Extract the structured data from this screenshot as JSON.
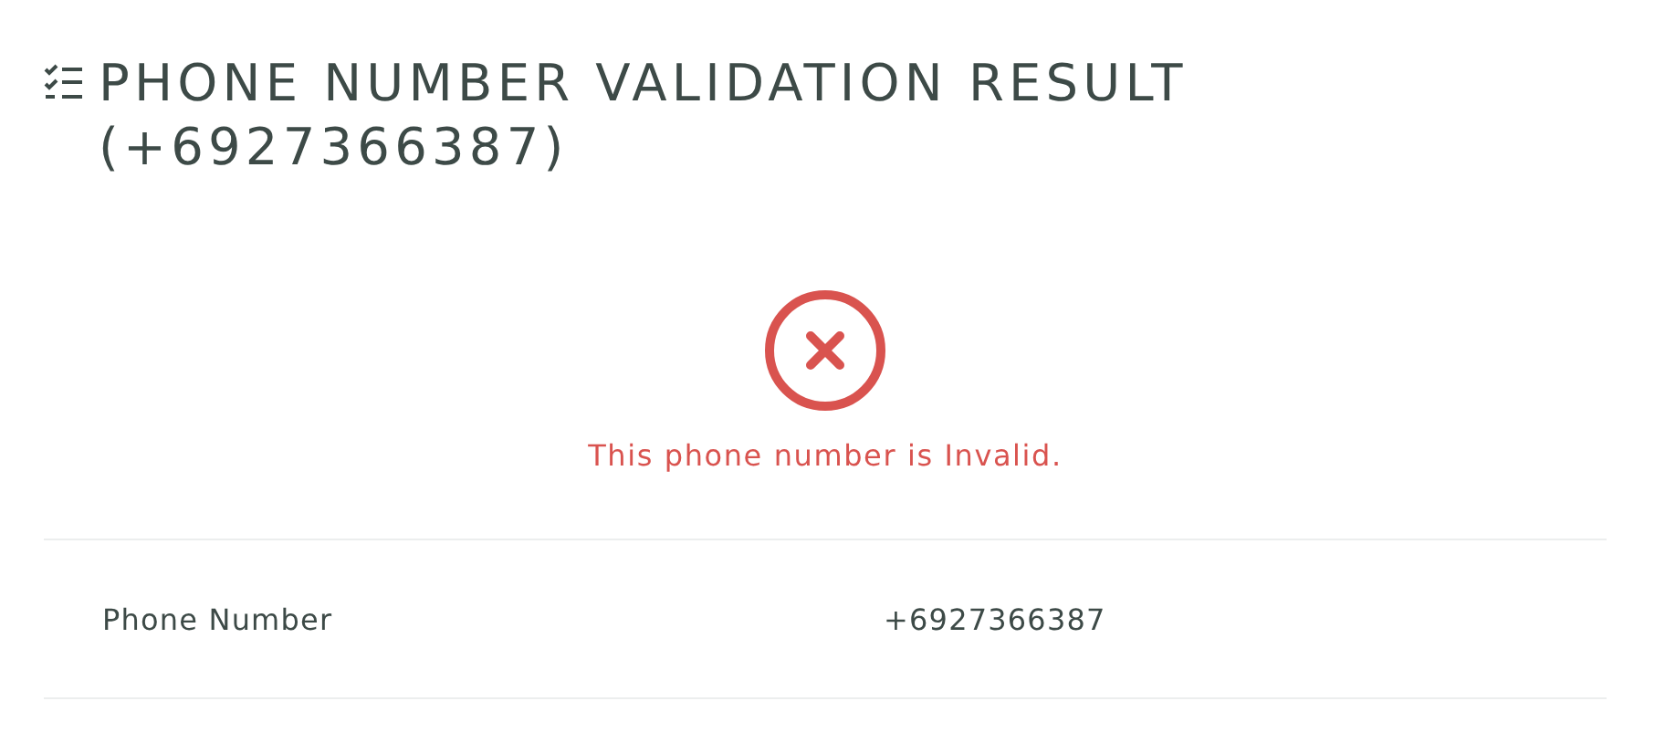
{
  "title": "PHONE NUMBER VALIDATION RESULT (+6927366387)",
  "result": {
    "kind": "invalid",
    "message": "This phone number is Invalid."
  },
  "details": [
    {
      "label": "Phone Number",
      "value": "+6927366387"
    }
  ]
}
